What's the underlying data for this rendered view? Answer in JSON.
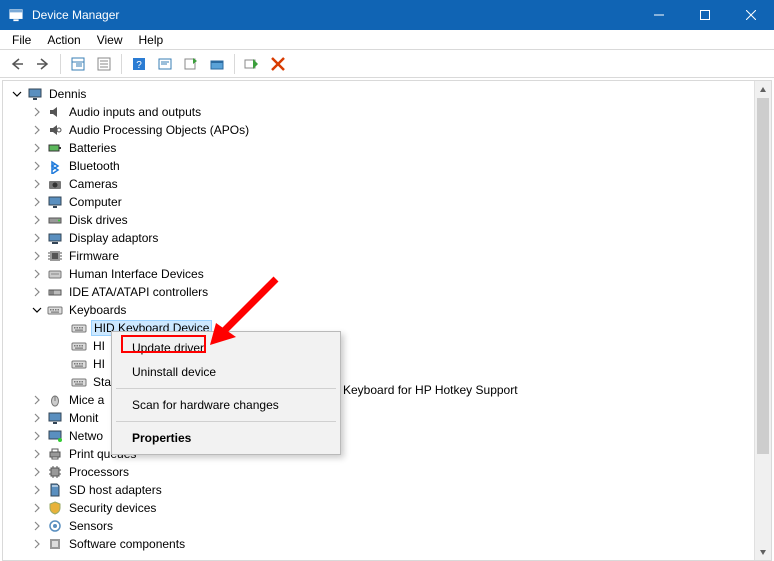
{
  "window": {
    "title": "Device Manager"
  },
  "menubar": [
    "File",
    "Action",
    "View",
    "Help"
  ],
  "tree": {
    "root": "Dennis",
    "categories": [
      {
        "label": "Audio inputs and outputs",
        "expanded": false
      },
      {
        "label": "Audio Processing Objects (APOs)",
        "expanded": false
      },
      {
        "label": "Batteries",
        "expanded": false
      },
      {
        "label": "Bluetooth",
        "expanded": false
      },
      {
        "label": "Cameras",
        "expanded": false
      },
      {
        "label": "Computer",
        "expanded": false
      },
      {
        "label": "Disk drives",
        "expanded": false
      },
      {
        "label": "Display adaptors",
        "expanded": false
      },
      {
        "label": "Firmware",
        "expanded": false
      },
      {
        "label": "Human Interface Devices",
        "expanded": false
      },
      {
        "label": "IDE ATA/ATAPI controllers",
        "expanded": false
      },
      {
        "label": "Keyboards",
        "expanded": true,
        "children": [
          {
            "label": "HID Keyboard Device",
            "selected": true
          },
          {
            "label": "HI"
          },
          {
            "label": "HI"
          },
          {
            "label": "Sta",
            "suffix_visible": "Keyboard for HP Hotkey Support"
          }
        ]
      },
      {
        "label": "Mice a",
        "expanded": false
      },
      {
        "label": "Monit",
        "expanded": false
      },
      {
        "label": "Netwo",
        "expanded": false
      },
      {
        "label": "Print queues",
        "expanded": false
      },
      {
        "label": "Processors",
        "expanded": false
      },
      {
        "label": "SD host adapters",
        "expanded": false
      },
      {
        "label": "Security devices",
        "expanded": false
      },
      {
        "label": "Sensors",
        "expanded": false
      },
      {
        "label": "Software components",
        "expanded": false
      }
    ]
  },
  "context_menu": {
    "items": [
      {
        "label": "Update driver",
        "highlighted": true
      },
      {
        "label": "Uninstall device"
      },
      {
        "sep": true
      },
      {
        "label": "Scan for hardware changes"
      },
      {
        "sep": true
      },
      {
        "label": "Properties",
        "bold": true
      }
    ]
  },
  "suffix_outside_menu": "Keyboard for HP Hotkey Support"
}
